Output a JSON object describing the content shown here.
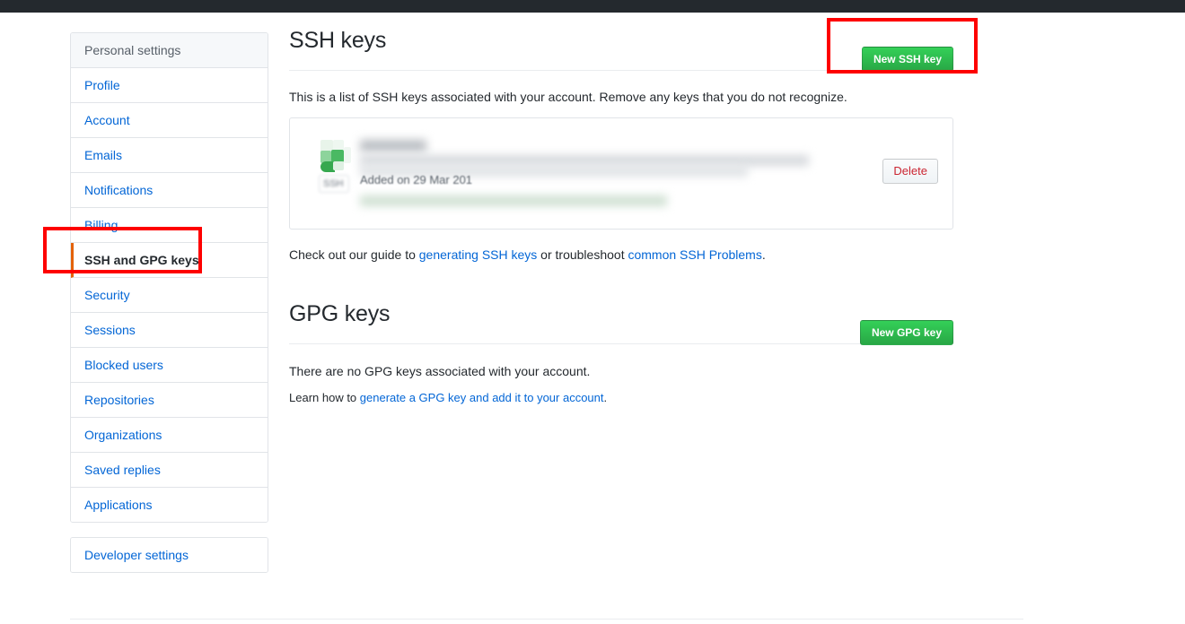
{
  "sidebar": {
    "header": "Personal settings",
    "items": [
      {
        "label": "Profile",
        "selected": false
      },
      {
        "label": "Account",
        "selected": false
      },
      {
        "label": "Emails",
        "selected": false
      },
      {
        "label": "Notifications",
        "selected": false
      },
      {
        "label": "Billing",
        "selected": false
      },
      {
        "label": "SSH and GPG keys",
        "selected": true
      },
      {
        "label": "Security",
        "selected": false
      },
      {
        "label": "Sessions",
        "selected": false
      },
      {
        "label": "Blocked users",
        "selected": false
      },
      {
        "label": "Repositories",
        "selected": false
      },
      {
        "label": "Organizations",
        "selected": false
      },
      {
        "label": "Saved replies",
        "selected": false
      },
      {
        "label": "Applications",
        "selected": false
      }
    ],
    "developer_settings": "Developer settings"
  },
  "ssh": {
    "title": "SSH keys",
    "new_button": "New SSH key",
    "description": "This is a list of SSH keys associated with your account. Remove any keys that you do not recognize.",
    "key": {
      "icon_name": "key-icon",
      "type_badge": "SSH",
      "added_on": "Added on 29 Mar 201",
      "delete_label": "Delete",
      "redacted": true
    },
    "guide_prefix": "Check out our guide to ",
    "guide_link_1": "generating SSH keys",
    "guide_middle": " or troubleshoot ",
    "guide_link_2": "common SSH Problems",
    "guide_suffix": "."
  },
  "gpg": {
    "title": "GPG keys",
    "new_button": "New GPG key",
    "empty_text": "There are no GPG keys associated with your account.",
    "learn_prefix": "Learn how to ",
    "learn_link": "generate a GPG key and add it to your account",
    "learn_suffix": "."
  },
  "annotations": {
    "color": "#fe0000",
    "boxes": [
      {
        "name": "new-ssh-key-highlight",
        "target": "New SSH key"
      },
      {
        "name": "sidebar-ssh-gpg-highlight",
        "target": "SSH and GPG keys"
      }
    ]
  },
  "colors": {
    "topbar": "#24292e",
    "green_button": "#28a745",
    "link": "#0366d6",
    "selected_accent": "#e36209",
    "delete_text": "#cb2431",
    "border": "#e1e4e8"
  }
}
